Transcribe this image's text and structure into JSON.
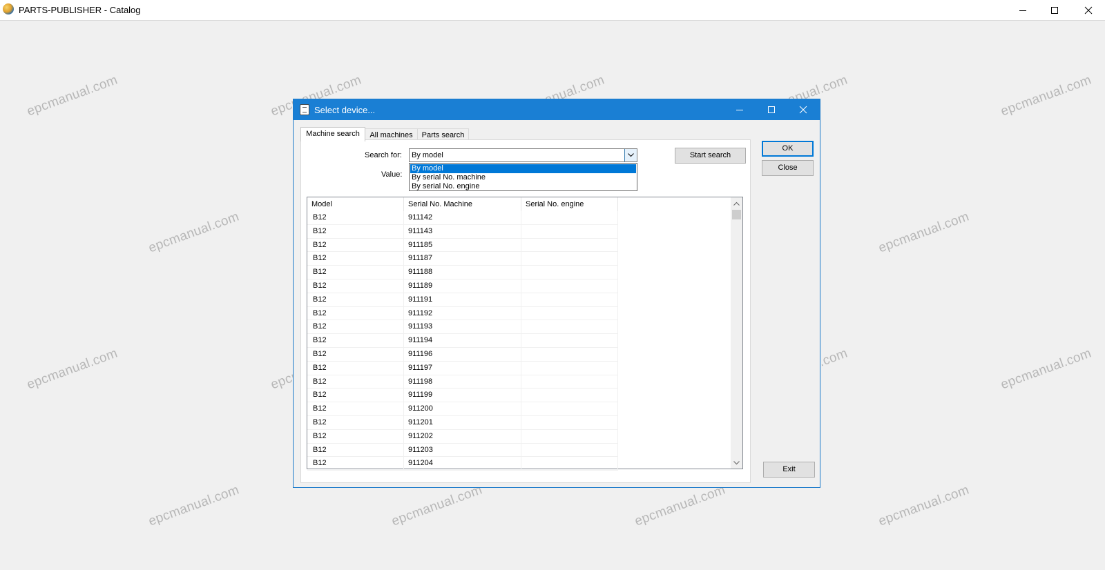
{
  "app": {
    "title": "PARTS-PUBLISHER - Catalog"
  },
  "watermark": "epcmanual.com",
  "dialog": {
    "title": "Select device...",
    "tabs": [
      "Machine search",
      "All machines",
      "Parts search"
    ],
    "search_for_label": "Search for:",
    "value_label": "Value:",
    "search_for_selected": "By model",
    "search_for_options": [
      "By model",
      "By serial No. machine",
      "By serial No. engine"
    ],
    "start_search_label": "Start search",
    "ok_label": "OK",
    "close_label": "Close",
    "exit_label": "Exit",
    "table": {
      "columns": [
        "Model",
        "Serial No. Machine",
        "Serial No. engine"
      ],
      "rows": [
        [
          "B12",
          "911142",
          ""
        ],
        [
          "B12",
          "911143",
          ""
        ],
        [
          "B12",
          "911185",
          ""
        ],
        [
          "B12",
          "911187",
          ""
        ],
        [
          "B12",
          "911188",
          ""
        ],
        [
          "B12",
          "911189",
          ""
        ],
        [
          "B12",
          "911191",
          ""
        ],
        [
          "B12",
          "911192",
          ""
        ],
        [
          "B12",
          "911193",
          ""
        ],
        [
          "B12",
          "911194",
          ""
        ],
        [
          "B12",
          "911196",
          ""
        ],
        [
          "B12",
          "911197",
          ""
        ],
        [
          "B12",
          "911198",
          ""
        ],
        [
          "B12",
          "911199",
          ""
        ],
        [
          "B12",
          "911200",
          ""
        ],
        [
          "B12",
          "911201",
          ""
        ],
        [
          "B12",
          "911202",
          ""
        ],
        [
          "B12",
          "911203",
          ""
        ],
        [
          "B12",
          "911204",
          ""
        ]
      ]
    }
  },
  "colors": {
    "titlebar_accent": "#1a7fd4",
    "selection": "#0078d7"
  }
}
